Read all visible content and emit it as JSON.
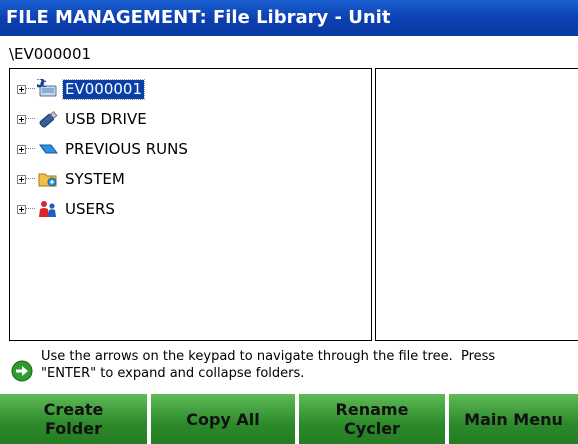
{
  "window": {
    "title": "FILE MANAGEMENT: File Library - Unit"
  },
  "path": "\\EV000001",
  "tree": {
    "items": [
      {
        "label": "EV000001",
        "icon": "unit-computer-icon",
        "selected": true
      },
      {
        "label": "USB DRIVE",
        "icon": "usb-drive-icon",
        "selected": false
      },
      {
        "label": "PREVIOUS RUNS",
        "icon": "previous-runs-icon",
        "selected": false
      },
      {
        "label": "SYSTEM",
        "icon": "system-folder-icon",
        "selected": false
      },
      {
        "label": "USERS",
        "icon": "users-icon",
        "selected": false
      }
    ]
  },
  "help": {
    "text_line1": "Use the arrows on the keypad to navigate through the file tree.  Press",
    "text_line2": "\"ENTER\" to expand and collapse folders."
  },
  "footer": {
    "create_folder_line1": "Create",
    "create_folder_line2": "Folder",
    "copy_all": "Copy All",
    "rename_cycler_line1": "Rename",
    "rename_cycler_line2": "Cycler",
    "main_menu": "Main Menu"
  },
  "colors": {
    "title_bar": "#0b3fb0",
    "selection": "#0a3fa8",
    "footer_button": "#2d8a2a"
  }
}
